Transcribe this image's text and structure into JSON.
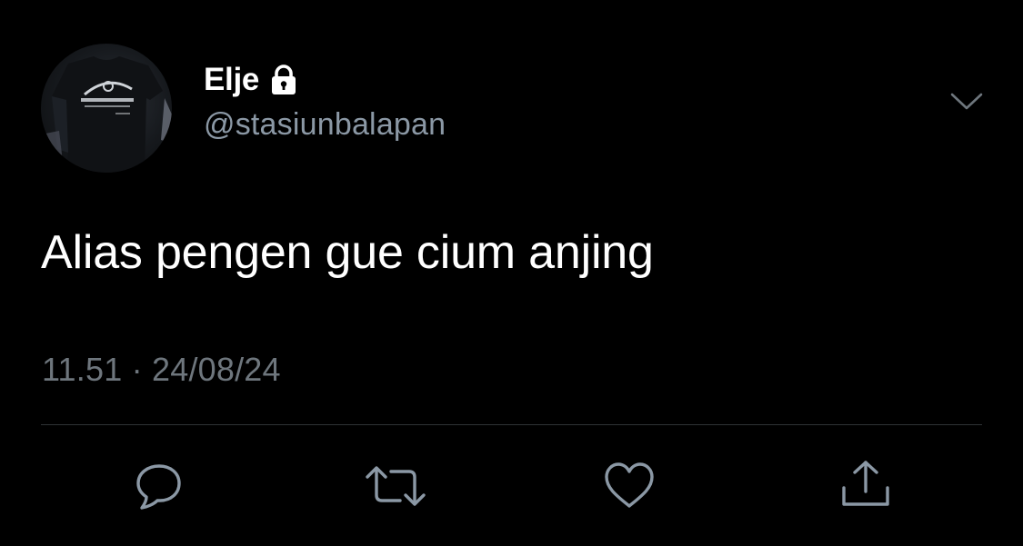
{
  "user": {
    "display_name": "Elje",
    "handle": "@stasiunbalapan",
    "protected_icon": "lock-icon",
    "avatar": "profile-photo"
  },
  "tweet": {
    "text": "Alias pengen gue cium anjing",
    "timestamp": "11.51 · 24/08/24"
  },
  "menu": {
    "icon": "chevron-down-icon"
  },
  "actions": [
    {
      "name": "reply",
      "icon": "reply-icon"
    },
    {
      "name": "retweet",
      "icon": "retweet-icon"
    },
    {
      "name": "like",
      "icon": "heart-icon"
    },
    {
      "name": "share",
      "icon": "share-icon"
    }
  ],
  "colors": {
    "background": "#000000",
    "text_primary": "#ffffff",
    "text_secondary": "#8b98a5",
    "timestamp": "#6e767d",
    "divider": "#2f3336",
    "icon": "#8b98a5"
  }
}
